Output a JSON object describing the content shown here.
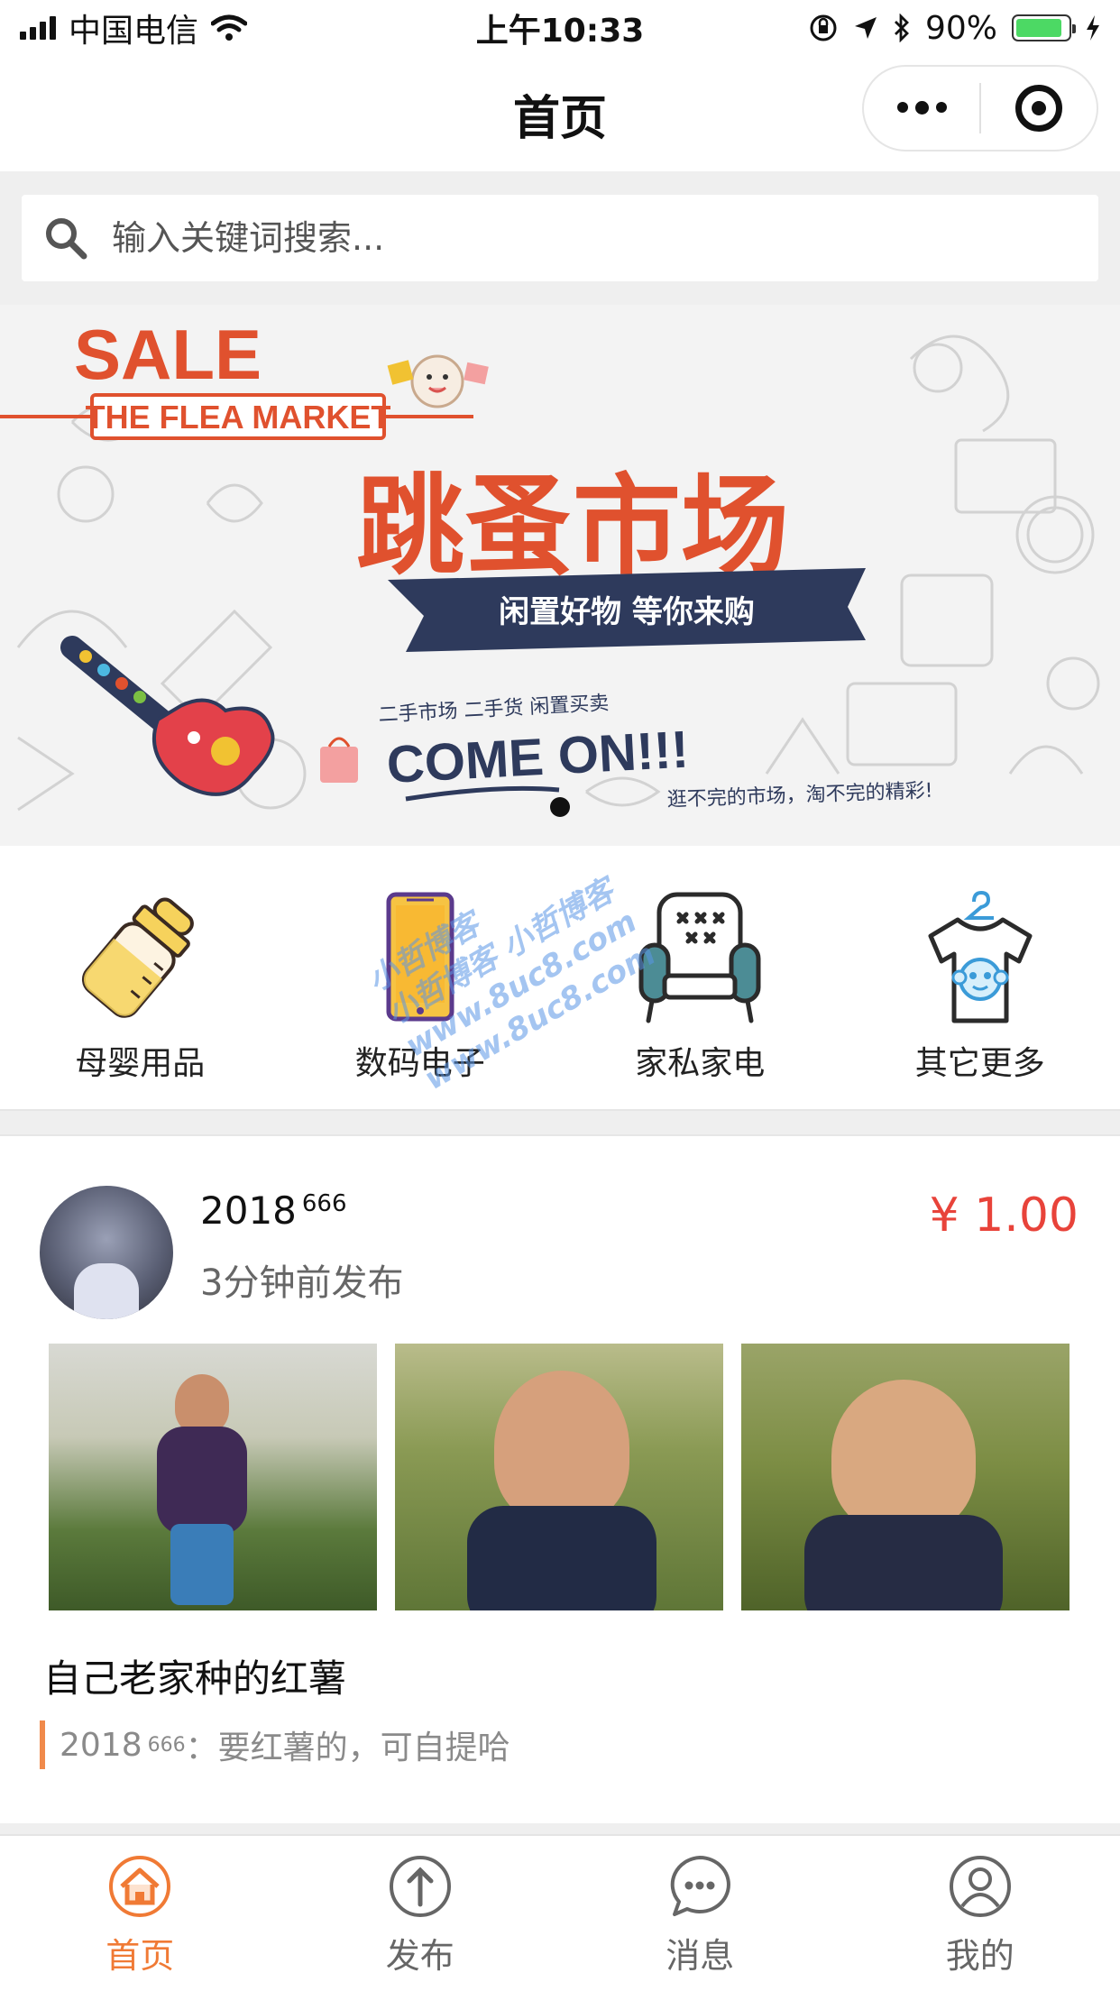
{
  "status_bar": {
    "carrier": "中国电信",
    "time": "上午10:33",
    "battery_percent": "90%",
    "battery_level": 0.9
  },
  "nav": {
    "title": "首页"
  },
  "search": {
    "placeholder": "输入关键词搜索..."
  },
  "banner": {
    "sale": "SALE",
    "market": "THE FLEA MARKET",
    "headline": "跳蚤市场",
    "ribbon": "闲置好物 等你来购",
    "small": "二手市场 二手货 闲置买卖",
    "come_on": "COME ON!!!",
    "tagline": "逛不完的市场，淘不完的精彩!",
    "slide_count": 1
  },
  "categories": [
    {
      "label": "母婴用品",
      "icon": "baby-bottle-icon"
    },
    {
      "label": "数码电子",
      "icon": "phone-icon"
    },
    {
      "label": "家私家电",
      "icon": "armchair-icon"
    },
    {
      "label": "其它更多",
      "icon": "tshirt-icon"
    }
  ],
  "post": {
    "user_name": "2018",
    "user_sup": "666",
    "time": "3分钟前发布",
    "price": "¥ 1.00",
    "title": "自己老家种的红薯",
    "comment_user": "2018",
    "comment_sup": "666",
    "comment_text": "：要红薯的，可自提哈"
  },
  "tabs": [
    {
      "label": "首页",
      "icon": "home-icon",
      "active": true
    },
    {
      "label": "发布",
      "icon": "upload-icon",
      "active": false
    },
    {
      "label": "消息",
      "icon": "message-icon",
      "active": false
    },
    {
      "label": "我的",
      "icon": "user-icon",
      "active": false
    }
  ],
  "watermark": {
    "line1": "小哲博客",
    "line2": "小哲博客 小哲博客",
    "line3": "www.8uc8.com",
    "line4": "www.8uc8.com"
  },
  "colors": {
    "accent": "#f07a35",
    "price": "#e8433a",
    "banner_red": "#e0512e",
    "banner_navy": "#2e3a5c"
  }
}
